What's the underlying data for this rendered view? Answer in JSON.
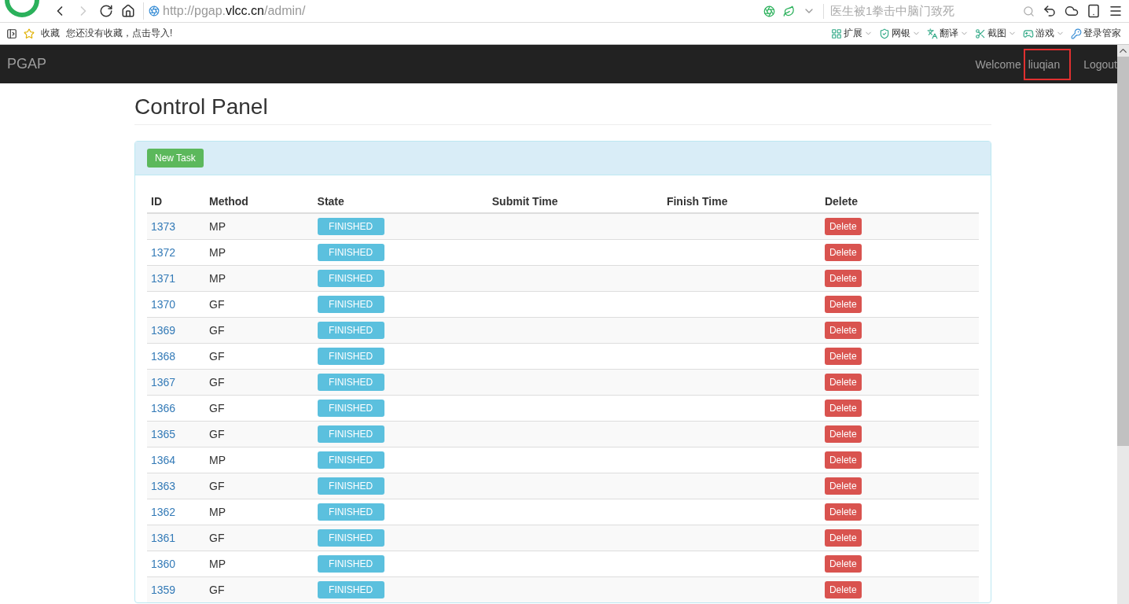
{
  "browser": {
    "url_prefix": "http://pgap.",
    "url_host": "vlcc.cn",
    "url_path": "/admin/",
    "search_placeholder": "医生被1拳击中脑门致死"
  },
  "bookmarks": {
    "favorites": "收藏",
    "empty_hint": "您还没有收藏，点击导入!",
    "tools": [
      "扩展",
      "网银",
      "翻译",
      "截图",
      "游戏"
    ],
    "login_manager": "登录管家"
  },
  "navbar": {
    "brand": "PGAP",
    "welcome": "Welcome",
    "user": "liuqian",
    "user_highlighted": true,
    "logout": "Logout"
  },
  "page": {
    "title": "Control Panel",
    "new_task": "New Task"
  },
  "table": {
    "columns": [
      "ID",
      "Method",
      "State",
      "Submit Time",
      "Finish Time",
      "Delete"
    ],
    "rows": [
      {
        "id": "1373",
        "method": "MP",
        "state": "FINISHED",
        "action": "Delete"
      },
      {
        "id": "1372",
        "method": "MP",
        "state": "FINISHED",
        "action": "Delete"
      },
      {
        "id": "1371",
        "method": "MP",
        "state": "FINISHED",
        "action": "Delete"
      },
      {
        "id": "1370",
        "method": "GF",
        "state": "FINISHED",
        "action": "Delete"
      },
      {
        "id": "1369",
        "method": "GF",
        "state": "FINISHED",
        "action": "Delete"
      },
      {
        "id": "1368",
        "method": "GF",
        "state": "FINISHED",
        "action": "Delete"
      },
      {
        "id": "1367",
        "method": "GF",
        "state": "FINISHED",
        "action": "Delete"
      },
      {
        "id": "1366",
        "method": "GF",
        "state": "FINISHED",
        "action": "Delete"
      },
      {
        "id": "1365",
        "method": "GF",
        "state": "FINISHED",
        "action": "Delete"
      },
      {
        "id": "1364",
        "method": "MP",
        "state": "FINISHED",
        "action": "Delete"
      },
      {
        "id": "1363",
        "method": "GF",
        "state": "FINISHED",
        "action": "Delete"
      },
      {
        "id": "1362",
        "method": "MP",
        "state": "FINISHED",
        "action": "Delete"
      },
      {
        "id": "1361",
        "method": "GF",
        "state": "FINISHED",
        "action": "Delete"
      },
      {
        "id": "1360",
        "method": "MP",
        "state": "FINISHED",
        "action": "Delete"
      },
      {
        "id": "1359",
        "method": "GF",
        "state": "FINISHED",
        "action": "Delete"
      }
    ]
  }
}
